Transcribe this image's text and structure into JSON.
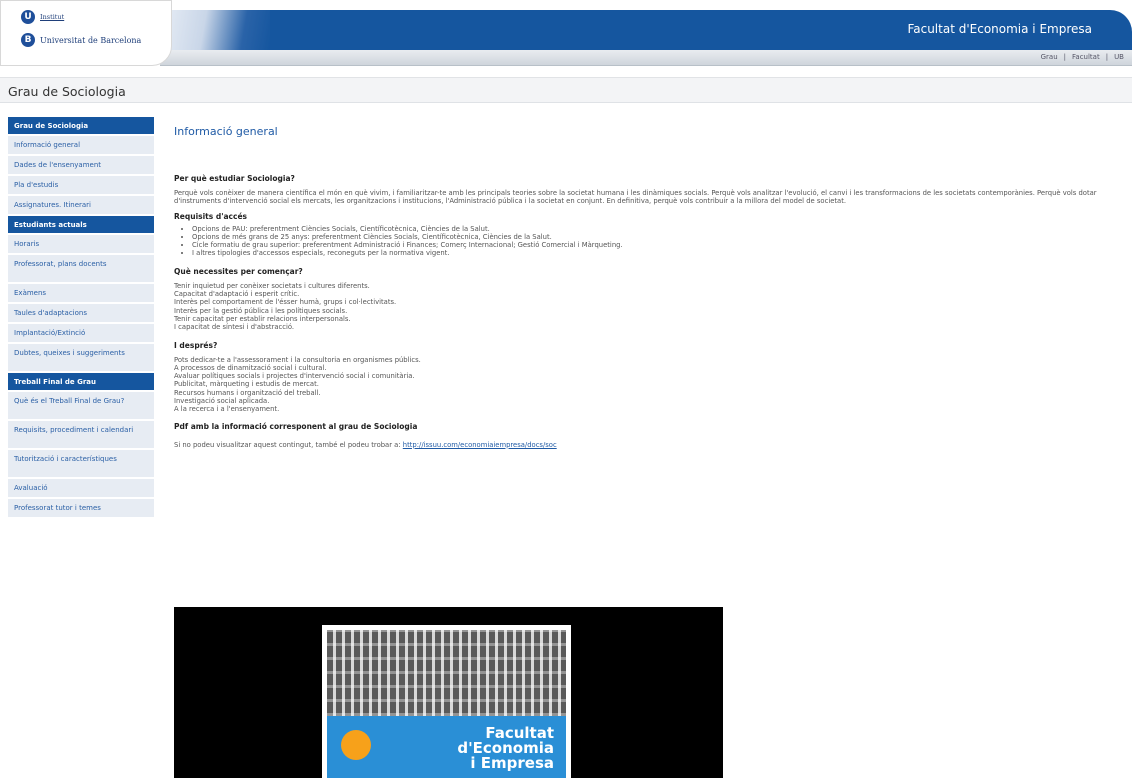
{
  "header": {
    "logo_line1": "Institut",
    "logo_line2": "Universitat de Barcelona",
    "banner_title": "Facultat d'Economia i Empresa",
    "top_links": [
      "Grau",
      "Facultat",
      "UB"
    ]
  },
  "page_title": "Grau de Sociologia",
  "sidebar": {
    "section1": {
      "heading": "Grau de Sociologia",
      "items": [
        "Informació general",
        "Dades de l'ensenyament",
        "Pla d'estudis",
        "Assignatures. Itinerari"
      ]
    },
    "section2": {
      "heading": "Estudiants actuals",
      "items": [
        "Horaris",
        "Professorat, plans docents",
        "Exàmens",
        "Taules d'adaptacions",
        "Implantació/Extinció",
        "Dubtes, queixes i suggeriments"
      ]
    },
    "section3": {
      "heading": "Treball Final de Grau",
      "items": [
        "Què és el Treball Final de Grau?",
        "Requisits, procediment i calendari",
        "Tutorització i característiques",
        "Avaluació",
        "Professorat tutor i temes"
      ]
    }
  },
  "main": {
    "section_title": "Informació general",
    "q1": {
      "heading": "Per què estudiar Sociologia?",
      "text": "Perquè vols conèixer de manera científica el món en què vivim, i familiaritzar-te amb les principals teories sobre la societat humana i les dinàmiques socials. Perquè vols analitzar l'evolució, el canvi i les transformacions de les societats contemporànies. Perquè vols dotar d'instruments d'intervenció social els mercats, les organitzacions i institucions, l'Administració pública i la societat en conjunt. En definitiva, perquè vols contribuir a la millora del model de societat."
    },
    "q2": {
      "heading": "Requisits d'accés",
      "items": [
        "Opcions de PAU: preferentment Ciències Socials, Científicotècnica, Ciències de la Salut.",
        "Opcions de més grans de 25 anys: preferentment Ciències Socials, Científicotècnica, Ciències de la Salut.",
        "Cicle formatiu de grau superior: preferentment Administració i Finances; Comerç Internacional; Gestió Comercial i Màrqueting.",
        "I altres tipologies d'accessos especials, reconeguts per la normativa vigent."
      ]
    },
    "q3": {
      "heading": "Què necessites per començar?",
      "lines": [
        "Tenir inquietud per conèixer societats i cultures diferents.",
        "Capacitat d'adaptació i esperit crític.",
        "Interès pel comportament de l'ésser humà, grups i col·lectivitats.",
        "Interès per la gestió pública i les polítiques socials.",
        "Tenir capacitat per establir relacions interpersonals.",
        "I capacitat de síntesi i d'abstracció."
      ]
    },
    "q4": {
      "heading": "I després?",
      "lines": [
        "Pots dedicar-te a l'assessorament i la consultoria en organismes públics.",
        "A processos de dinamització social i cultural.",
        "Avaluar polítiques socials i projectes d'intervenció social i comunitària.",
        "Publicitat, màrqueting i estudis de mercat.",
        "Recursos humans i organització del treball.",
        "Investigació social aplicada.",
        "A la recerca i a l'ensenyament."
      ]
    },
    "pdf": {
      "heading": "Pdf amb la informació corresponent al grau de Sociologia",
      "text": "Si no podeu visualitzar aquest contingut, també el podeu trobar a:",
      "link": "http://issuu.com/economiaiempresa/docs/soc"
    },
    "cover_text": "Facultat\nd'Economia\ni Empresa"
  }
}
